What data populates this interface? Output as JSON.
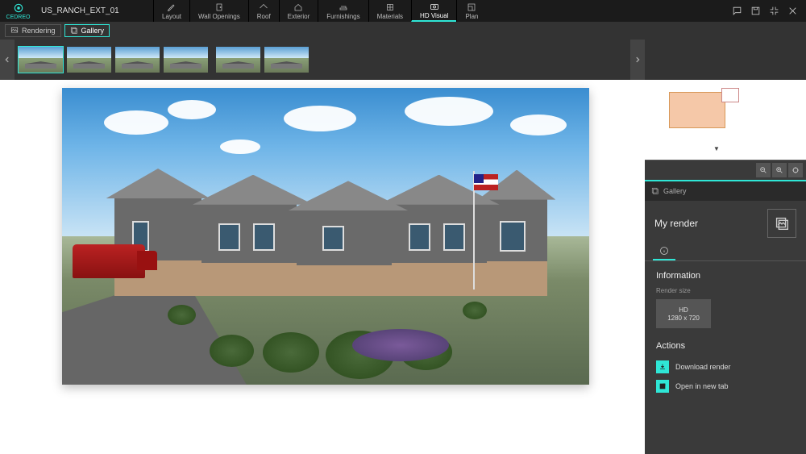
{
  "app": {
    "brand": "CEDREO",
    "project_name": "US_RANCH_EXT_01"
  },
  "main_tabs": [
    {
      "label": "Layout"
    },
    {
      "label": "Wall Openings"
    },
    {
      "label": "Roof"
    },
    {
      "label": "Exterior"
    },
    {
      "label": "Furnishings"
    },
    {
      "label": "Materials"
    },
    {
      "label": "HD Visual"
    },
    {
      "label": "Plan"
    }
  ],
  "sub_tabs": {
    "rendering": "Rendering",
    "gallery": "Gallery"
  },
  "panel": {
    "tab_label": "Gallery",
    "title": "My render",
    "info_heading": "Information",
    "render_size_label": "Render size",
    "render_size_name": "HD",
    "render_size_value": "1280 x 720",
    "actions_heading": "Actions",
    "action_download": "Download render",
    "action_open": "Open in new tab"
  }
}
